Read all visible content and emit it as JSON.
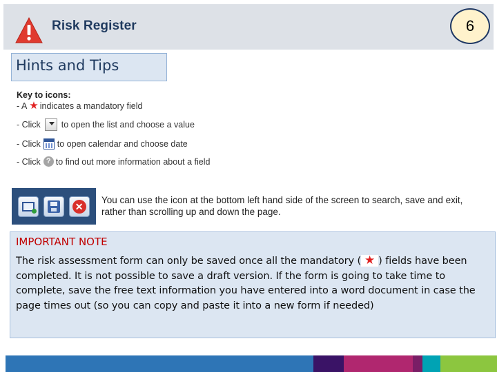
{
  "header": {
    "title": "Risk Register",
    "page_number": "6"
  },
  "hints": {
    "title": "Hints and Tips"
  },
  "key": {
    "title": "Key to icons:",
    "rows": [
      {
        "prefix": "- A",
        "suffix": "indicates a mandatory field",
        "icon": "red-star-icon"
      },
      {
        "prefix": "- Click",
        "suffix": "to open the list and choose a value",
        "icon": "dropdown-icon"
      },
      {
        "prefix": "- Click",
        "suffix": "to open calendar and choose date",
        "icon": "calendar-icon"
      },
      {
        "prefix": "- Click",
        "suffix": "to find out more information about a field",
        "icon": "help-icon"
      }
    ]
  },
  "toolbar": {
    "description": "You can use the icon at the bottom left hand side of the screen to search, save and exit, rather than scrolling up and down the page."
  },
  "note": {
    "title": "IMPORTANT NOTE",
    "text_before_star": "The risk assessment form can only be saved once all the mandatory (",
    "text_after_star": ") fields have been completed. It is not possible to save a draft version. If the form is going to take time to complete, save the free text information you have entered into a word document in case the page times out (so you can copy and paste it into a new form if needed)"
  },
  "colors": {
    "header_bg": "#dde1e7",
    "title_text": "#1f3a5f",
    "note_title": "#c00000",
    "mandatory_star": "#e02020",
    "toolbar_bg": "#2c4f7c",
    "footer_stripe": [
      "#ffffff",
      "#2e75b6",
      "#3a1366",
      "#b0276f",
      "#7a1e66",
      "#00a3b4",
      "#8cc63f"
    ]
  }
}
